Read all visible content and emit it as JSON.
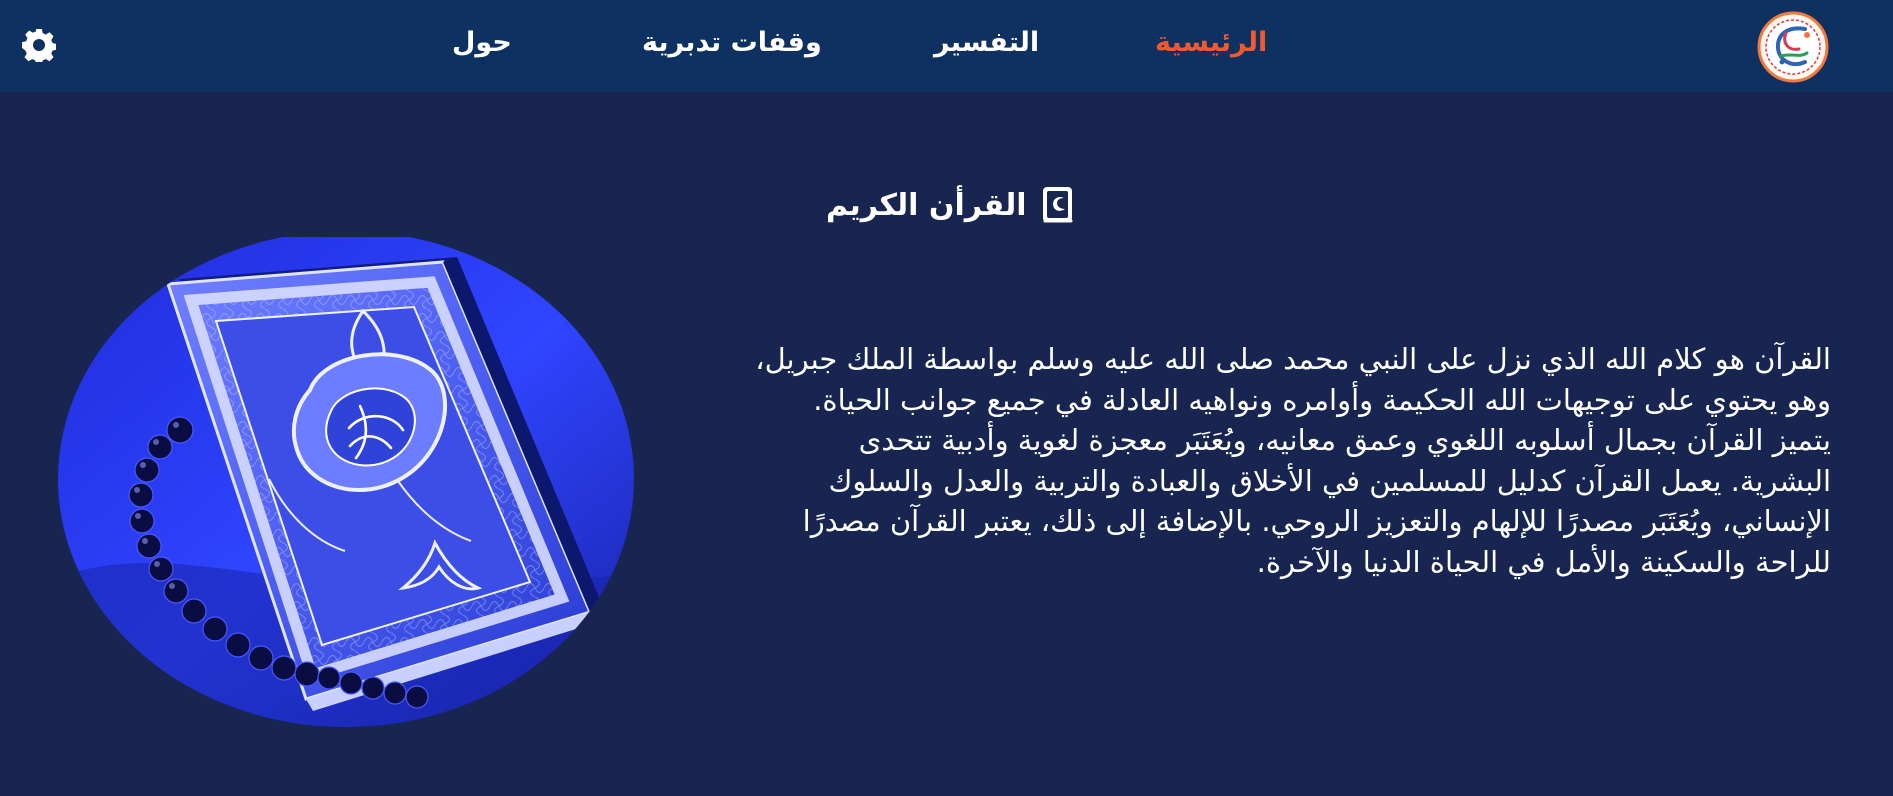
{
  "nav": {
    "logo_icon": "quran-logo-icon",
    "items": [
      {
        "label": "الرئيسية",
        "active": true
      },
      {
        "label": "التفسير",
        "active": false
      },
      {
        "label": "وقفات تدبرية",
        "active": false
      },
      {
        "label": "حول",
        "active": false
      }
    ],
    "settings_icon": "gear-icon"
  },
  "main": {
    "title": "القرأن الكريم",
    "title_icon": "book-icon",
    "intro": "القرآن هو كلام الله الذي نزل على النبي محمد صلى الله عليه وسلم بواسطة الملك جبريل، وهو يحتوي على توجيهات الله الحكيمة وأوامره ونواهيه العادلة في جميع جوانب الحياة. يتميز القرآن بجمال أسلوبه اللغوي وعمق معانيه، ويُعَتَبَر معجزة لغوية وأدبية تتحدى البشرية. يعمل القرآن كدليل للمسلمين في الأخلاق والعبادة والتربية والعدل والسلوك الإنساني، ويُعَتَبَر مصدرًا للإلهام والتعزيز الروحي. بالإضافة إلى ذلك، يعتبر القرآن مصدرًا للراحة والسكينة والأمل في الحياة الدنيا والآخرة.",
    "image": "quran-book-with-prayer-beads"
  },
  "colors": {
    "background": "#172550",
    "navbar": "#0f3161",
    "active_nav": "#ef5b2f",
    "text": "#ffffff",
    "book_blue": "#2d3fe0"
  }
}
